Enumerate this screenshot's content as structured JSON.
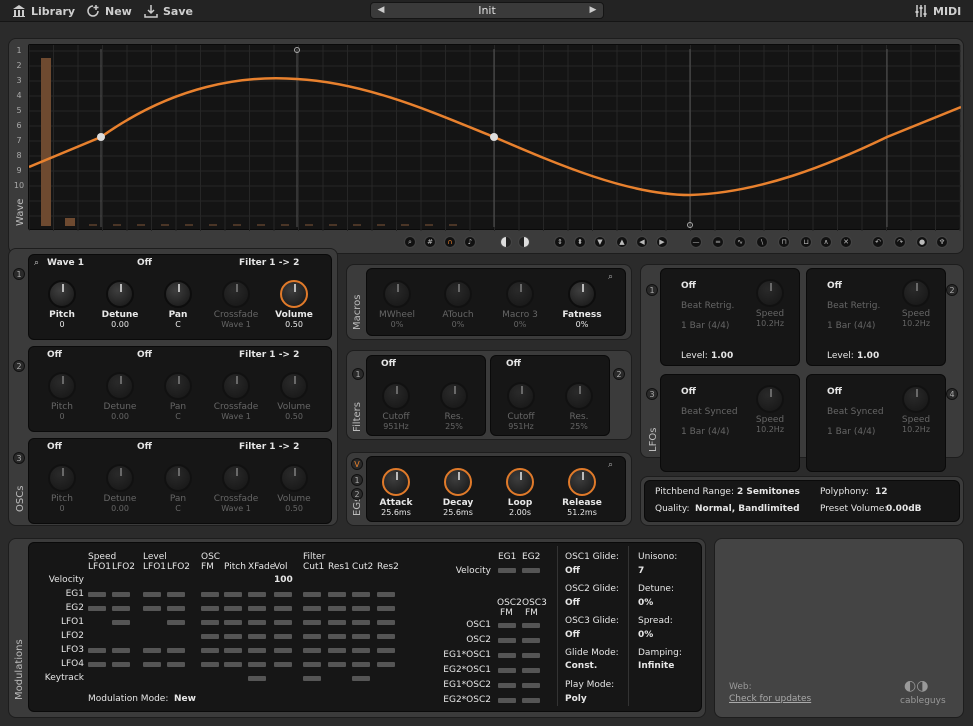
{
  "topbar": {
    "library": "Library",
    "new": "New",
    "save": "Save",
    "preset": "Init",
    "midi": "MIDI"
  },
  "wave": {
    "label": "Wave",
    "rows": [
      "1",
      "2",
      "3",
      "4",
      "5",
      "6",
      "7",
      "8",
      "9",
      "10"
    ]
  },
  "osc": {
    "label": "OSCs",
    "osc1": {
      "num": "1",
      "wave": "Wave 1",
      "mode": "Off",
      "route": "Filter 1 -> 2"
    },
    "osc2": {
      "num": "2",
      "wave": "Off",
      "mode": "Off",
      "route": "Filter 1 -> 2"
    },
    "osc3": {
      "num": "3",
      "wave": "Off",
      "mode": "Off",
      "route": "Filter 1 -> 2"
    },
    "knobs": {
      "pitch": "Pitch",
      "detune": "Detune",
      "pan": "Pan",
      "crossfade": "Crossfade",
      "volume": "Volume"
    },
    "vals": {
      "pitch": "0",
      "detune": "0.00",
      "pan": "C",
      "crossfade": "Wave 1",
      "volume": "0.50"
    }
  },
  "macros": {
    "label": "Macros",
    "m1": "MWheel",
    "m2": "ATouch",
    "m3": "Macro 3",
    "m4": "Fatness",
    "v1": "0%",
    "v2": "0%",
    "v3": "0%",
    "v4": "0%"
  },
  "filters": {
    "label": "Filters",
    "f1": "Off",
    "f2": "Off",
    "n1": "1",
    "n2": "2",
    "cutoff": "Cutoff",
    "res": "Res.",
    "cv": "951Hz",
    "rv": "25%"
  },
  "egs": {
    "label": "EGs",
    "v": "V",
    "n1": "1",
    "n2": "2",
    "attack": "Attack",
    "decay": "Decay",
    "loop": "Loop",
    "release": "Release",
    "av": "25.6ms",
    "dv": "25.6ms",
    "lv": "2.00s",
    "rv": "51.2ms"
  },
  "lfos": {
    "label": "LFOs",
    "l1": {
      "num": "1",
      "mode": "Off",
      "sync": "Beat Retrig.",
      "rate": "1 Bar (4/4)",
      "level_label": "Level:",
      "level": "1.00"
    },
    "l2": {
      "num": "2",
      "mode": "Off",
      "sync": "Beat Retrig.",
      "rate": "1 Bar (4/4)",
      "level_label": "Level:",
      "level": "1.00"
    },
    "l3": {
      "num": "3",
      "mode": "Off",
      "sync": "Beat Synced",
      "rate": "1 Bar (4/4)"
    },
    "l4": {
      "num": "4",
      "mode": "Off",
      "sync": "Beat Synced",
      "rate": "1 Bar (4/4)"
    },
    "speed": "Speed",
    "speed_val": "10.2Hz"
  },
  "global": {
    "pb_label": "Pitchbend Range:",
    "pb": "2 Semitones",
    "poly_label": "Polyphony:",
    "poly": "12",
    "q_label": "Quality:",
    "q": "Normal, Bandlimited",
    "pv_label": "Preset Volume:",
    "pv": "0.00dB"
  },
  "mod": {
    "label": "Modulations",
    "h_speed": "Speed",
    "h_level": "Level",
    "h_osc": "OSC",
    "h_filter": "Filter",
    "cols": [
      "LFO1",
      "LFO2",
      "LFO1",
      "LFO2",
      "FM",
      "Pitch",
      "XFade",
      "Vol",
      "Cut1",
      "Res1",
      "Cut2",
      "Res2"
    ],
    "rows": [
      "Velocity",
      "EG1",
      "EG2",
      "LFO1",
      "LFO2",
      "LFO3",
      "LFO4",
      "Keytrack"
    ],
    "vel_vol": "100",
    "mode_label": "Modulation Mode:",
    "mode": "New",
    "r_eg1": "EG1",
    "r_eg2": "EG2",
    "r_velocity": "Velocity",
    "r_osc2fm": "OSC2",
    "r_osc3fm": "OSC3",
    "r_fm": "FM",
    "r_rows": [
      "OSC1",
      "OSC2",
      "EG1*OSC1",
      "EG2*OSC1",
      "EG1*OSC2",
      "EG2*OSC2"
    ],
    "g1l": "OSC1 Glide:",
    "g1": "Off",
    "g2l": "OSC2 Glide:",
    "g2": "Off",
    "g3l": "OSC3 Glide:",
    "g3": "Off",
    "gml": "Glide Mode:",
    "gm": "Const.",
    "pml": "Play Mode:",
    "pm": "Poly",
    "ul": "Unisono:",
    "u": "7",
    "dl": "Detune:",
    "d": "0%",
    "sl": "Spread:",
    "s": "0%",
    "dml": "Damping:",
    "dm": "Infinite"
  },
  "info": {
    "web": "Web:",
    "link": "Check for updates",
    "brand": "cableguys"
  },
  "colors": {
    "accent": "#e8812e",
    "bg": "#2b2b2b"
  }
}
